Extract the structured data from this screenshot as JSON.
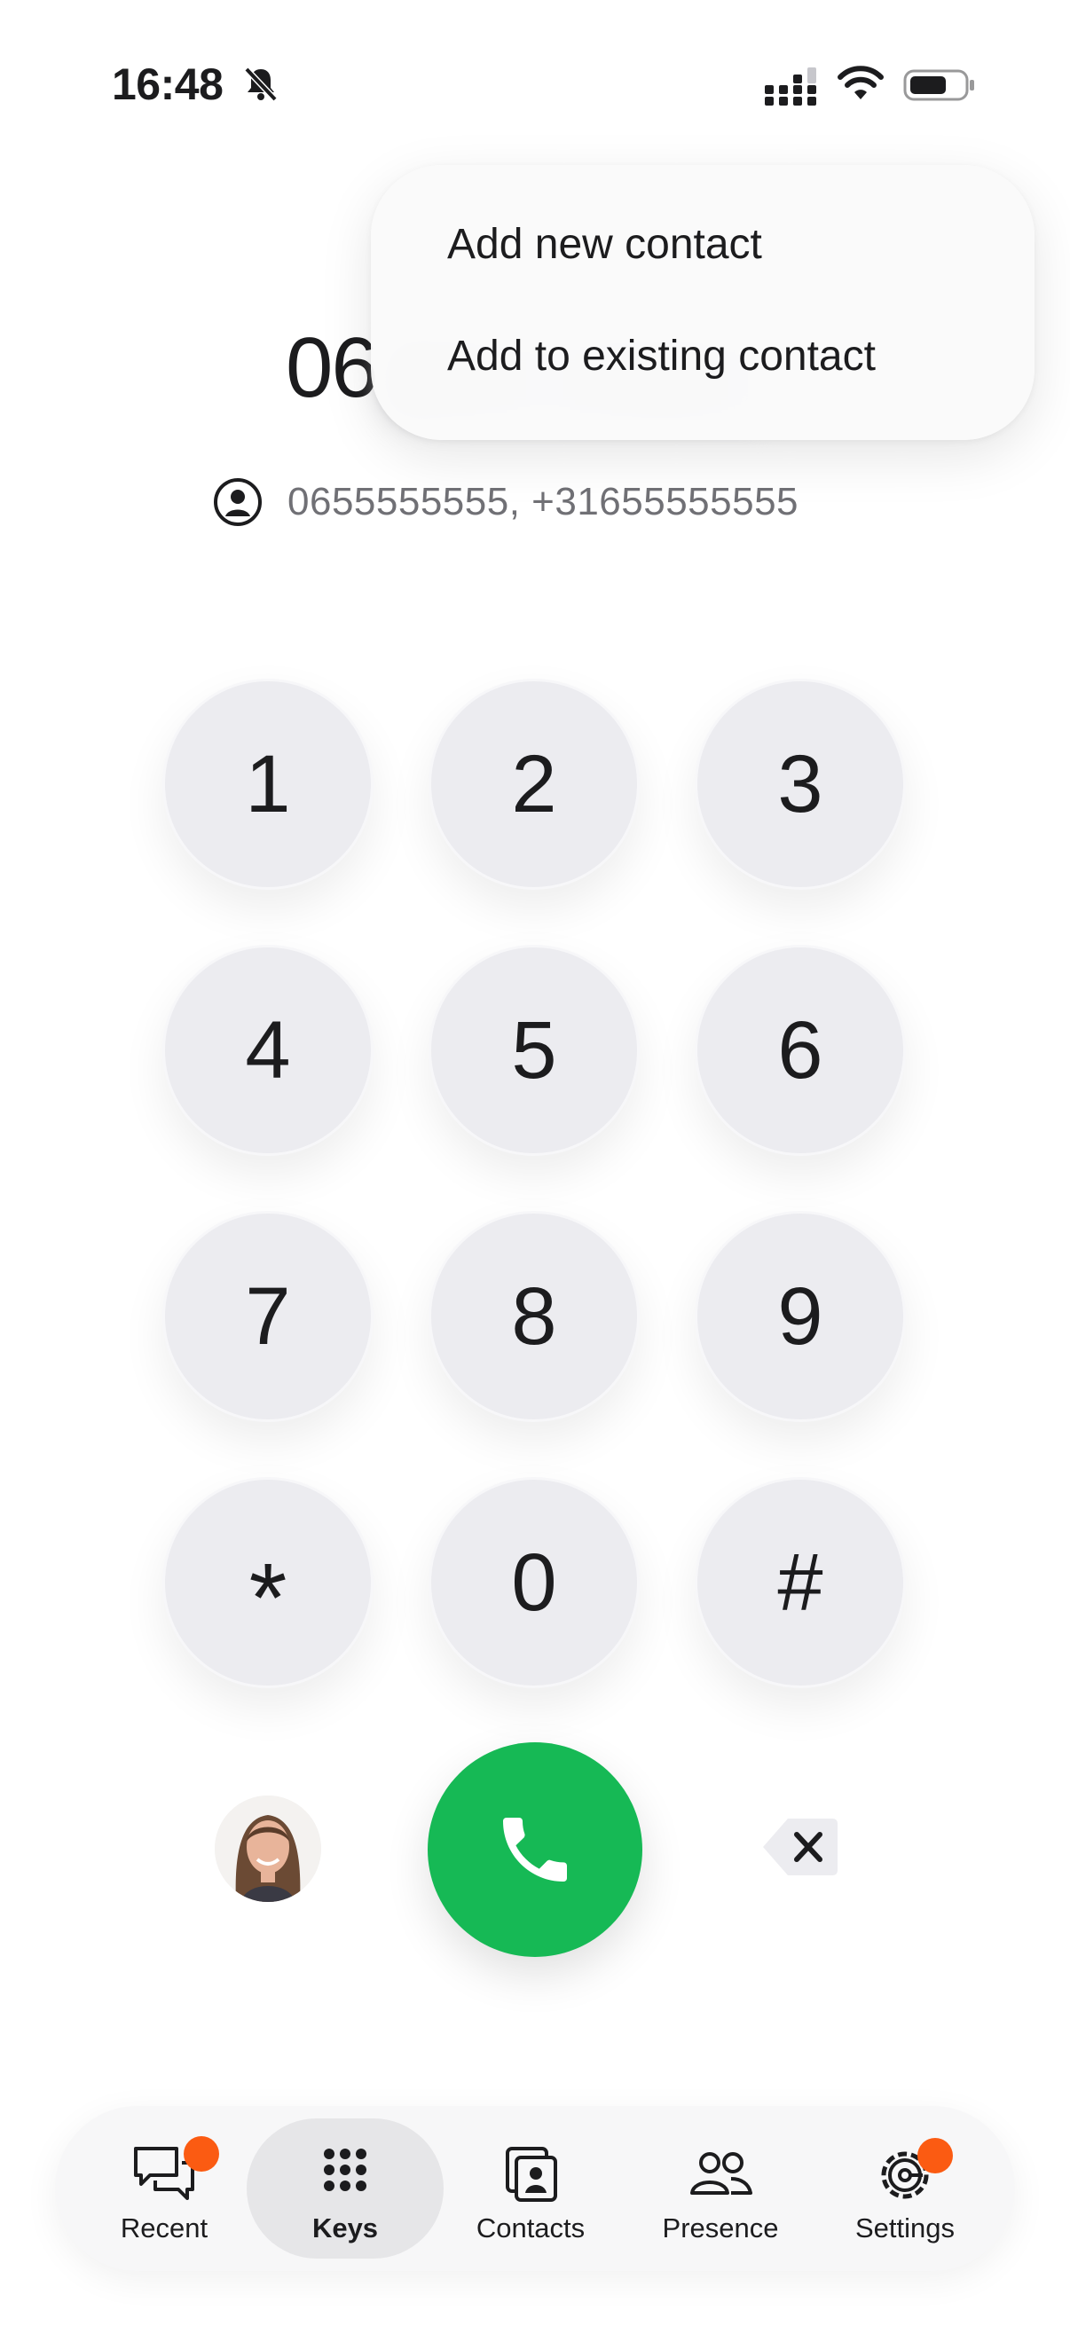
{
  "status_bar": {
    "time": "16:48",
    "icons": [
      "bell-slash-icon",
      "signal-icon",
      "wifi-icon",
      "battery-icon"
    ]
  },
  "dialer": {
    "number_prefix": "06",
    "number_rest_blurred": true,
    "match_icon": "person-circle-icon",
    "match_text": "0655555555, +31655555555"
  },
  "popup_menu": {
    "items": [
      "Add new contact",
      "Add to existing contact"
    ]
  },
  "keypad": {
    "keys": [
      "1",
      "2",
      "3",
      "4",
      "5",
      "6",
      "7",
      "8",
      "9",
      "*",
      "0",
      "#"
    ]
  },
  "actions": {
    "avatar": "avatar",
    "call_icon": "phone-icon",
    "delete_icon": "backspace-icon",
    "call_color": "#16b955"
  },
  "tabbar": {
    "tabs": [
      {
        "label": "Recent",
        "icon": "chat-bubbles-icon",
        "badge": true
      },
      {
        "label": "Keys",
        "icon": "keypad-grid-icon",
        "active": true
      },
      {
        "label": "Contacts",
        "icon": "contact-cards-icon"
      },
      {
        "label": "Presence",
        "icon": "people-icon"
      },
      {
        "label": "Settings",
        "icon": "gear-icon",
        "badge": true
      }
    ],
    "badge_color": "#fb5b12"
  }
}
